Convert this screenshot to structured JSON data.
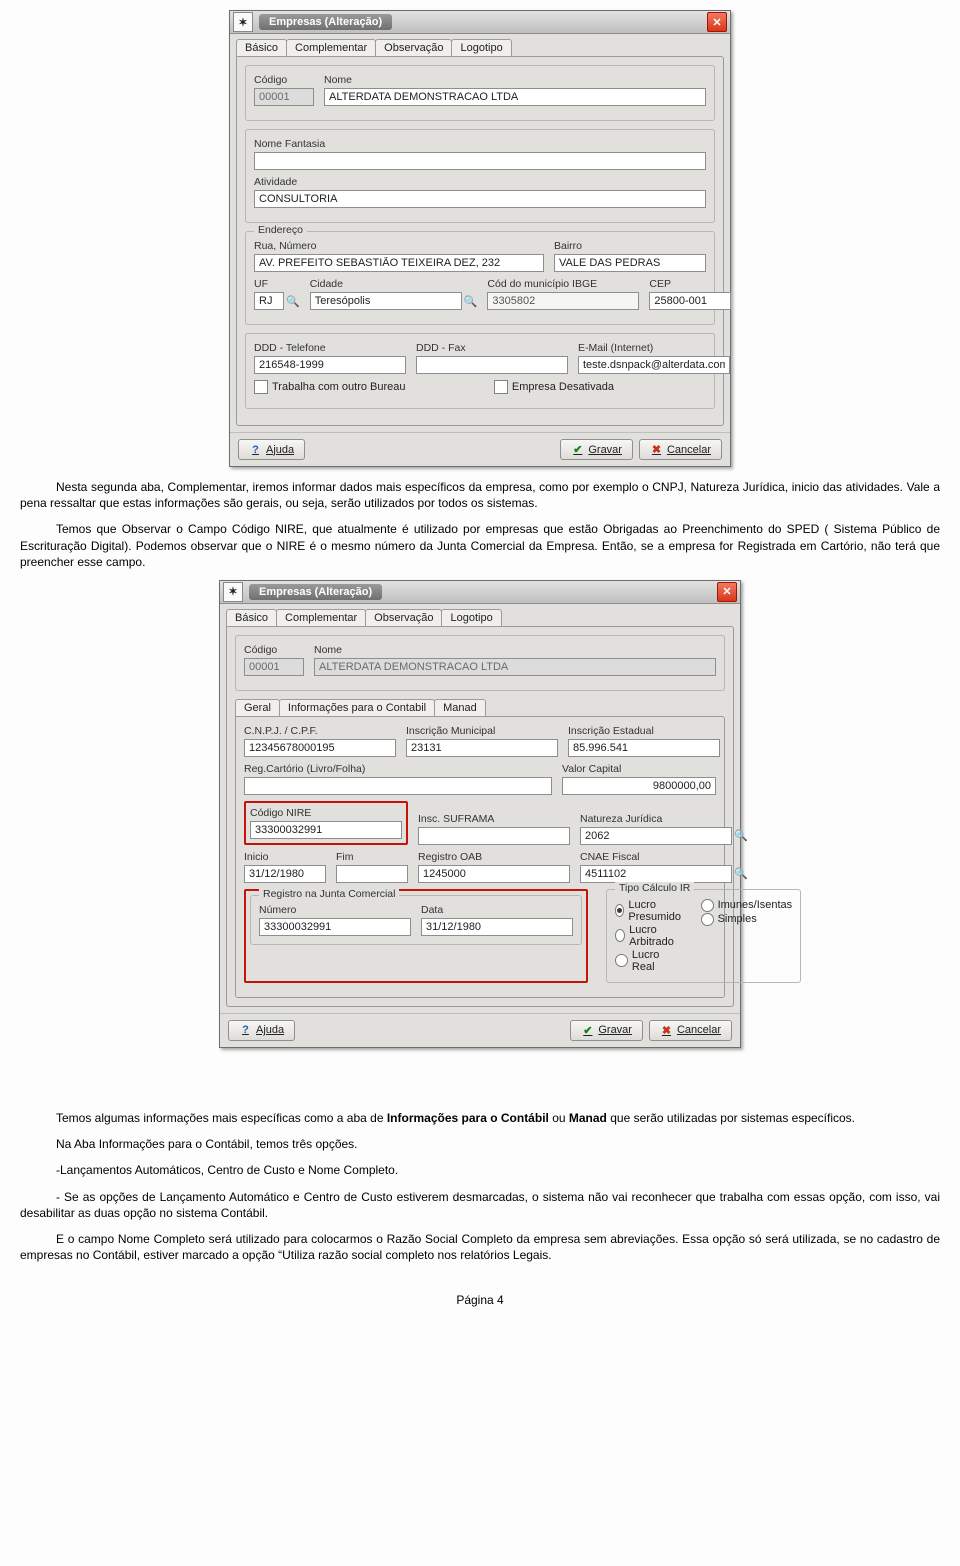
{
  "window1": {
    "title": "Empresas (Alteração)",
    "icon_glyph": "✕",
    "tabs": [
      "Básico",
      "Complementar",
      "Observação",
      "Logotipo"
    ],
    "codigo_label": "Código",
    "codigo_value": "00001",
    "nome_label": "Nome",
    "nome_value": "ALTERDATA DEMONSTRACAO LTDA",
    "nomefantasia_label": "Nome Fantasia",
    "nomefantasia_value": "",
    "atividade_label": "Atividade",
    "atividade_value": "CONSULTORIA",
    "endereco_legend": "Endereço",
    "rua_label": "Rua, Número",
    "rua_value": "AV. PREFEITO SEBASTIÃO TEIXEIRA DEZ, 232",
    "bairro_label": "Bairro",
    "bairro_value": "VALE DAS PEDRAS",
    "uf_label": "UF",
    "uf_value": "RJ",
    "cidade_label": "Cidade",
    "cidade_value": "Teresópolis",
    "ibge_label": "Cód do município IBGE",
    "ibge_value": "3305802",
    "cep_label": "CEP",
    "cep_value": "25800-001",
    "ddd_tel_label": "DDD - Telefone",
    "ddd_tel_value": "216548-1999",
    "ddd_fax_label": "DDD - Fax",
    "ddd_fax_value": "",
    "email_label": "E-Mail (Internet)",
    "email_value": "teste.dsnpack@alterdata.com.br",
    "cb_bureau": "Trabalha com outro Bureau",
    "cb_desativada": "Empresa Desativada",
    "ajuda": "Ajuda",
    "gravar": "Gravar",
    "cancelar": "Cancelar"
  },
  "para1": "Nesta segunda aba, Complementar, iremos informar dados mais específicos da empresa, como por exemplo o CNPJ, Natureza Jurídica, inicio das atividades. Vale a pena ressaltar que estas informações são gerais, ou seja, serão utilizados por todos os sistemas.",
  "para2": "Temos que Observar o Campo Código NIRE, que atualmente é utilizado por empresas que estão Obrigadas ao Preenchimento do SPED ( Sistema Público de Escrituração Digital). Podemos observar que o NIRE é o mesmo número da Junta Comercial da Empresa. Então, se a empresa for Registrada em Cartório, não terá que preencher esse campo.",
  "window2": {
    "title": "Empresas (Alteração)",
    "tabs_top": [
      "Básico",
      "Complementar",
      "Observação",
      "Logotipo"
    ],
    "codigo_label": "Código",
    "codigo_value": "00001",
    "nome_label": "Nome",
    "nome_value": "ALTERDATA DEMONSTRACAO LTDA",
    "subtabs": [
      "Geral",
      "Informações para o Contabil",
      "Manad"
    ],
    "cnpj_label": "C.N.P.J. / C.P.F.",
    "cnpj_value": "12345678000195",
    "insc_mun_label": "Inscrição Municipal",
    "insc_mun_value": "23131",
    "insc_est_label": "Inscrição Estadual",
    "insc_est_value": "85.996.541",
    "regcart_label": "Reg.Cartório (Livro/Folha)",
    "regcart_value": "",
    "valorcap_label": "Valor Capital",
    "valorcap_value": "9800000,00",
    "nire_label": "Código NIRE",
    "nire_value": "33300032991",
    "suframa_label": "Insc. SUFRAMA",
    "suframa_value": "",
    "nat_label": "Natureza Jurídica",
    "nat_value": "2062",
    "inicio_label": "Inicio",
    "inicio_value": "31/12/1980",
    "fim_label": "Fim",
    "fim_value": "",
    "oab_label": "Registro OAB",
    "oab_value": "1245000",
    "cnae_label": "CNAE Fiscal",
    "cnae_value": "4511102",
    "junta_legend": "Registro na Junta Comercial",
    "junta_num_label": "Número",
    "junta_num_value": "33300032991",
    "junta_data_label": "Data",
    "junta_data_value": "31/12/1980",
    "tipocalc_legend": "Tipo Cálculo IR",
    "r_presumido": "Lucro Presumido",
    "r_arbitrado": "Lucro Arbitrado",
    "r_real": "Lucro Real",
    "r_imunes": "Imunes/Isentas",
    "r_simples": "Simples",
    "ajuda": "Ajuda",
    "gravar": "Gravar",
    "cancelar": "Cancelar"
  },
  "para3_a": "Temos algumas informações mais específicas como a aba de ",
  "para3_b": "Informações para o Contábil",
  "para3_c": " ou ",
  "para3_d": "Manad",
  "para3_e": " que serão utilizadas por sistemas específicos.",
  "para4": "Na Aba Informações para o Contábil, temos três opções.",
  "para5": "-Lançamentos Automáticos, Centro de Custo e Nome Completo.",
  "para6": "- Se as opções de Lançamento Automático e Centro de Custo estiverem desmarcadas, o sistema não vai reconhecer que trabalha com essas opção, com isso, vai desabilitar as duas opção no sistema Contábil.",
  "para7": "E o campo Nome Completo será utilizado para colocarmos o Razão Social Completo da empresa sem abreviações. Essa opção só será utilizada, se no cadastro de empresas no Contábil, estiver marcado a opção “Utiliza razão social completo nos relatórios Legais.",
  "page_number": "Página 4"
}
